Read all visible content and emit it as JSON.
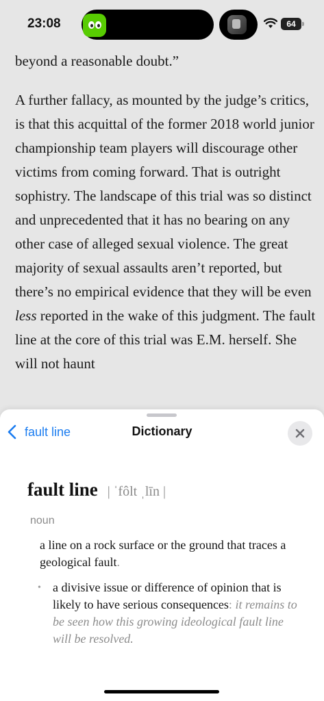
{
  "status_bar": {
    "time": "23:08",
    "battery": "64",
    "app_icon": "duolingo-icon",
    "media_icon": "album-art-icon",
    "wifi_icon": "wifi-icon"
  },
  "article": {
    "p1": "beyond a reasonable doubt.”",
    "p2_before": "A further fallacy, as mounted by the judge’s critics, is that this acquittal of the former 2018 world junior championship team players will discourage other victims from coming forward. That is outright sophistry. The landscape of this trial was so distinct and unprecedented that it has no bearing on any other case of alleged sexual violence. The great majority of sexual assaults aren’t reported, but there’s no empirical evidence that they will be even ",
    "p2_em": "less",
    "p2_after": " reported in the wake of this judgment. The fault line at the core of this trial was E.M. herself. She will not haunt"
  },
  "dictionary": {
    "back_label": "fault line",
    "title": "Dictionary",
    "headword": "fault line",
    "pronunciation": "| ˈfôlt ˌlīn |",
    "part_of_speech": "noun",
    "definition1": "a line on a rock surface or the ground that traces a geological fault",
    "definition1_end": ".",
    "definition2": "a divisive issue or difference of opinion that is likely to have serious consequences",
    "definition2_sep": ":",
    "example2": " it remains to be seen how this growing ideological fault line will be resolved."
  },
  "colors": {
    "accent": "#1a7cf0",
    "background": "#e6e6e6",
    "sheet": "#ffffff",
    "secondary_text": "#8a8a8a"
  }
}
